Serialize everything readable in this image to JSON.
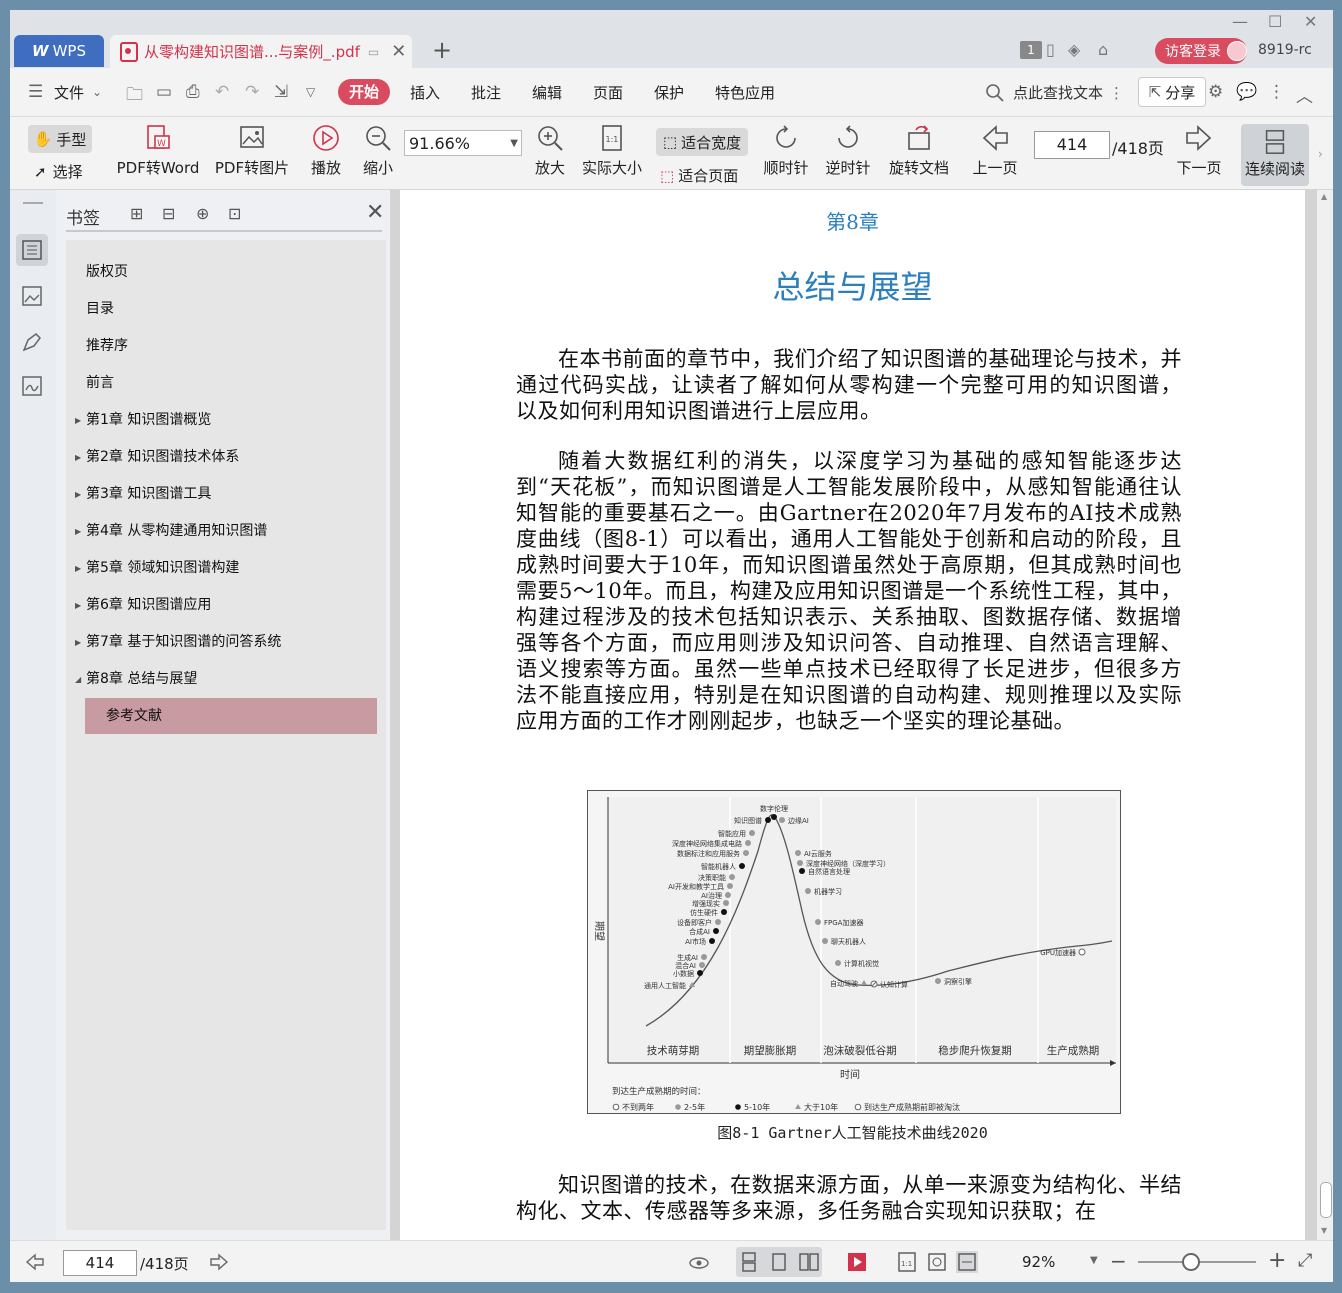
{
  "tabbar": {
    "app_label": "WPS",
    "doc_tab_title": "从零构建知识图谱...与案例_.pdf",
    "page_badge": "1",
    "guest_login": "访客登录",
    "user_id": "8919-rc"
  },
  "menubar": {
    "file": "文件",
    "start": "开始",
    "items": [
      "插入",
      "批注",
      "编辑",
      "页面",
      "保护",
      "特色应用"
    ],
    "search": "点此查找文本",
    "share": "分享"
  },
  "toolbar": {
    "hand": "手型",
    "select": "选择",
    "pdf_to_word": "PDF转Word",
    "pdf_to_image": "PDF转图片",
    "play": "播放",
    "zoom_out": "缩小",
    "zoom_value": "91.66%",
    "zoom_in": "放大",
    "actual_size": "实际大小",
    "fit_width": "适合宽度",
    "fit_page": "适合页面",
    "clockwise": "顺时针",
    "counter_clockwise": "逆时针",
    "rotate_doc": "旋转文档",
    "prev_page": "上一页",
    "page_value": "414",
    "page_total": "/418页",
    "next_page": "下一页",
    "continuous": "连续阅读"
  },
  "bookmarks": {
    "title": "书签",
    "items": [
      {
        "label": "版权页"
      },
      {
        "label": "目录"
      },
      {
        "label": "推荐序"
      },
      {
        "label": "前言"
      },
      {
        "label": "第1章 知识图谱概览"
      },
      {
        "label": "第2章 知识图谱技术体系"
      },
      {
        "label": "第3章 知识图谱工具"
      },
      {
        "label": "第4章 从零构建通用知识图谱"
      },
      {
        "label": "第5章 领域知识图谱构建"
      },
      {
        "label": "第6章 知识图谱应用"
      },
      {
        "label": "第7章 基于知识图谱的问答系统"
      },
      {
        "label": "第8章 总结与展望"
      },
      {
        "label": "参考文献"
      }
    ]
  },
  "document": {
    "chapter_label": "第8章",
    "chapter_title": "总结与展望",
    "para1": "在本书前面的章节中，我们介绍了知识图谱的基础理论与技术，并通过代码实战，让读者了解如何从零构建一个完整可用的知识图谱，以及如何利用知识图谱进行上层应用。",
    "para2": "随着大数据红利的消失，以深度学习为基础的感知智能逐步达到“天花板”，而知识图谱是人工智能发展阶段中，从感知智能通往认知智能的重要基石之一。由Gartner在2020年7月发布的AI技术成熟度曲线（图8-1）可以看出，通用人工智能处于创新和启动的阶段，且成熟时间要大于10年，而知识图谱虽然处于高原期，但其成熟时间也需要5～10年。而且，构建及应用知识图谱是一个系统性工程，其中，构建过程涉及的技术包括知识表示、关系抽取、图数据存储、数据增强等各个方面，而应用则涉及知识问答、自动推理、自然语言理解、语义搜索等方面。虽然一些单点技术已经取得了长足进步，但很多方法不能直接应用，特别是在知识图谱的自动构建、规则推理以及实际应用方面的工作才刚刚起步，也缺乏一个坚实的理论基础。",
    "para3": "知识图谱的技术，在数据来源方面，从单一来源变为结构化、半结构化、文本、传感器等多来源，多任务融合实现知识获取；在",
    "figure_caption": "图8-1   Gartner人工智能技术曲线2020"
  },
  "chart_data": {
    "type": "line",
    "title": "",
    "xlabel": "时间",
    "ylabel": "期望",
    "phases": [
      "技术萌芽期",
      "期望膨胀期",
      "泡沫破裂低谷期",
      "稳步爬升恢复期",
      "生产成熟期"
    ],
    "legend_title": "到达生产成熟期的时间：",
    "legend": [
      "不到两年",
      "2-5年",
      "5-10年",
      "大于10年",
      "到达生产成熟期前即被淘汰"
    ],
    "points": [
      {
        "label": "通用人工智能",
        "phase": "技术萌芽期",
        "maturity": "大于10年"
      },
      {
        "label": "小数据",
        "phase": "技术萌芽期",
        "maturity": "5-10年"
      },
      {
        "label": "混合AI",
        "phase": "技术萌芽期",
        "maturity": "2-5年"
      },
      {
        "label": "生成AI",
        "phase": "技术萌芽期",
        "maturity": "2-5年"
      },
      {
        "label": "AI市场",
        "phase": "期望膨胀期",
        "maturity": "5-10年"
      },
      {
        "label": "合成AI",
        "phase": "期望膨胀期",
        "maturity": "5-10年"
      },
      {
        "label": "设备即客户",
        "phase": "期望膨胀期",
        "maturity": "2-5年"
      },
      {
        "label": "仿生硬件",
        "phase": "期望膨胀期",
        "maturity": "5-10年"
      },
      {
        "label": "增强现实",
        "phase": "期望膨胀期",
        "maturity": "2-5年"
      },
      {
        "label": "AI治理",
        "phase": "期望膨胀期",
        "maturity": "2-5年"
      },
      {
        "label": "AI开发和教学工具",
        "phase": "期望膨胀期",
        "maturity": "2-5年"
      },
      {
        "label": "决策职能",
        "phase": "期望膨胀期",
        "maturity": "2-5年"
      },
      {
        "label": "智能机器人",
        "phase": "期望膨胀期",
        "maturity": "5-10年"
      },
      {
        "label": "数据标注和应用服务",
        "phase": "期望膨胀期",
        "maturity": "2-5年"
      },
      {
        "label": "深度神经网络集成电路",
        "phase": "期望膨胀期",
        "maturity": "2-5年"
      },
      {
        "label": "智能应用",
        "phase": "期望膨胀期",
        "maturity": "2-5年"
      },
      {
        "label": "知识图谱",
        "phase": "期望膨胀期",
        "maturity": "5-10年"
      },
      {
        "label": "数字伦理",
        "phase": "期望膨胀期",
        "maturity": "5-10年"
      },
      {
        "label": "边缘AI",
        "phase": "期望膨胀期",
        "maturity": "2-5年"
      },
      {
        "label": "AI云服务",
        "phase": "泡沫破裂低谷期",
        "maturity": "2-5年"
      },
      {
        "label": "深度神经网络（深度学习）",
        "phase": "泡沫破裂低谷期",
        "maturity": "2-5年"
      },
      {
        "label": "自然语言处理",
        "phase": "泡沫破裂低谷期",
        "maturity": "5-10年"
      },
      {
        "label": "机器学习",
        "phase": "泡沫破裂低谷期",
        "maturity": "2-5年"
      },
      {
        "label": "FPGA加速器",
        "phase": "泡沫破裂低谷期",
        "maturity": "2-5年"
      },
      {
        "label": "聊天机器人",
        "phase": "泡沫破裂低谷期",
        "maturity": "2-5年"
      },
      {
        "label": "计算机视觉",
        "phase": "泡沫破裂低谷期",
        "maturity": "2-5年"
      },
      {
        "label": "自动驾驶",
        "phase": "泡沫破裂低谷期",
        "maturity": "大于10年"
      },
      {
        "label": "认知计算",
        "phase": "泡沫破裂低谷期",
        "maturity": "到达生产成熟期前即被淘汰"
      },
      {
        "label": "洞察引擎",
        "phase": "稳步爬升恢复期",
        "maturity": "2-5年"
      },
      {
        "label": "GPU加速器",
        "phase": "生产成熟期",
        "maturity": "不到两年"
      }
    ]
  },
  "statusbar": {
    "page_value": "414",
    "page_total": "/418页",
    "zoom": "92%"
  }
}
